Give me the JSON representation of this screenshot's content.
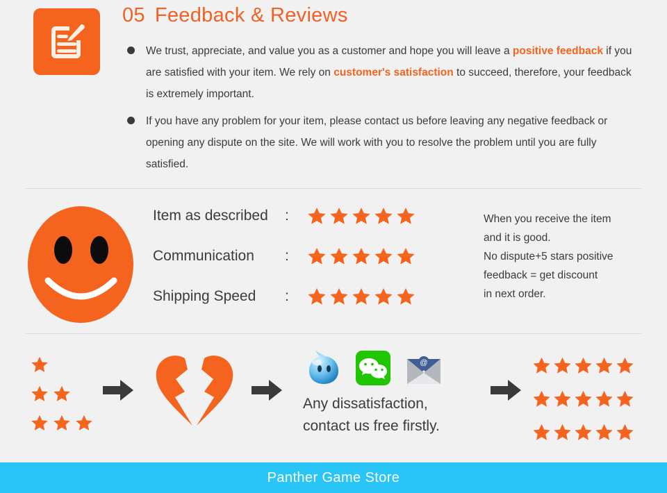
{
  "theme": {
    "background": "#f1f1f1",
    "accent_orange": "#f4641e",
    "title_orange": "#ef6126",
    "text_dark": "#3b3b3b",
    "arrow_gray": "#3a3a3a",
    "footer_blue": "#29c5f6",
    "divider_gray": "#dcdcdc"
  },
  "header": {
    "icon_name": "document-edit-icon",
    "number": "05",
    "title": "Feedback & Reviews",
    "bullets": [
      {
        "parts": [
          {
            "text": "We trust, appreciate, and value you as a customer and hope you will leave a ",
            "emphasis": false
          },
          {
            "text": "positive feedback",
            "emphasis": true
          },
          {
            "text": " if you are satisfied with your item. We rely on ",
            "emphasis": false
          },
          {
            "text": "customer's satisfaction",
            "emphasis": true
          },
          {
            "text": " to succeed, therefore, your feedback is extremely important.",
            "emphasis": false
          }
        ]
      },
      {
        "parts": [
          {
            "text": "If you have any problem for your item, please contact us before leaving any negative feedback or opening any dispute on the site. We will work with you to resolve the problem until you are fully satisfied.",
            "emphasis": false
          }
        ]
      }
    ]
  },
  "ratings": {
    "smiley_icon": "smiley-face-icon",
    "rows": [
      {
        "label": "Item as described",
        "colon": ":",
        "stars": 5
      },
      {
        "label": "Communication",
        "colon": ":",
        "stars": 5
      },
      {
        "label": "Shipping Speed",
        "colon": ":",
        "stars": 5
      }
    ],
    "note_lines": [
      "When you receive the item",
      "and it is good.",
      "No dispute+5 stars positive",
      "feedback =  get discount",
      "in next order."
    ]
  },
  "flow": {
    "bad_star_rows": [
      1,
      2,
      3
    ],
    "arrow_icon": "right-arrow-icon",
    "broken_heart_icon": "broken-heart-icon",
    "contact_icons": [
      {
        "name": "aliwangwang-icon",
        "label": "AliWangWang"
      },
      {
        "name": "wechat-icon",
        "label": "WeChat"
      },
      {
        "name": "email-icon",
        "label": "Email"
      }
    ],
    "contact_lines": [
      "Any dissatisfaction,",
      "contact us free firstly."
    ],
    "good_star_rows": [
      5,
      5,
      5
    ]
  },
  "footer": {
    "store_name": "Panther Game Store"
  }
}
